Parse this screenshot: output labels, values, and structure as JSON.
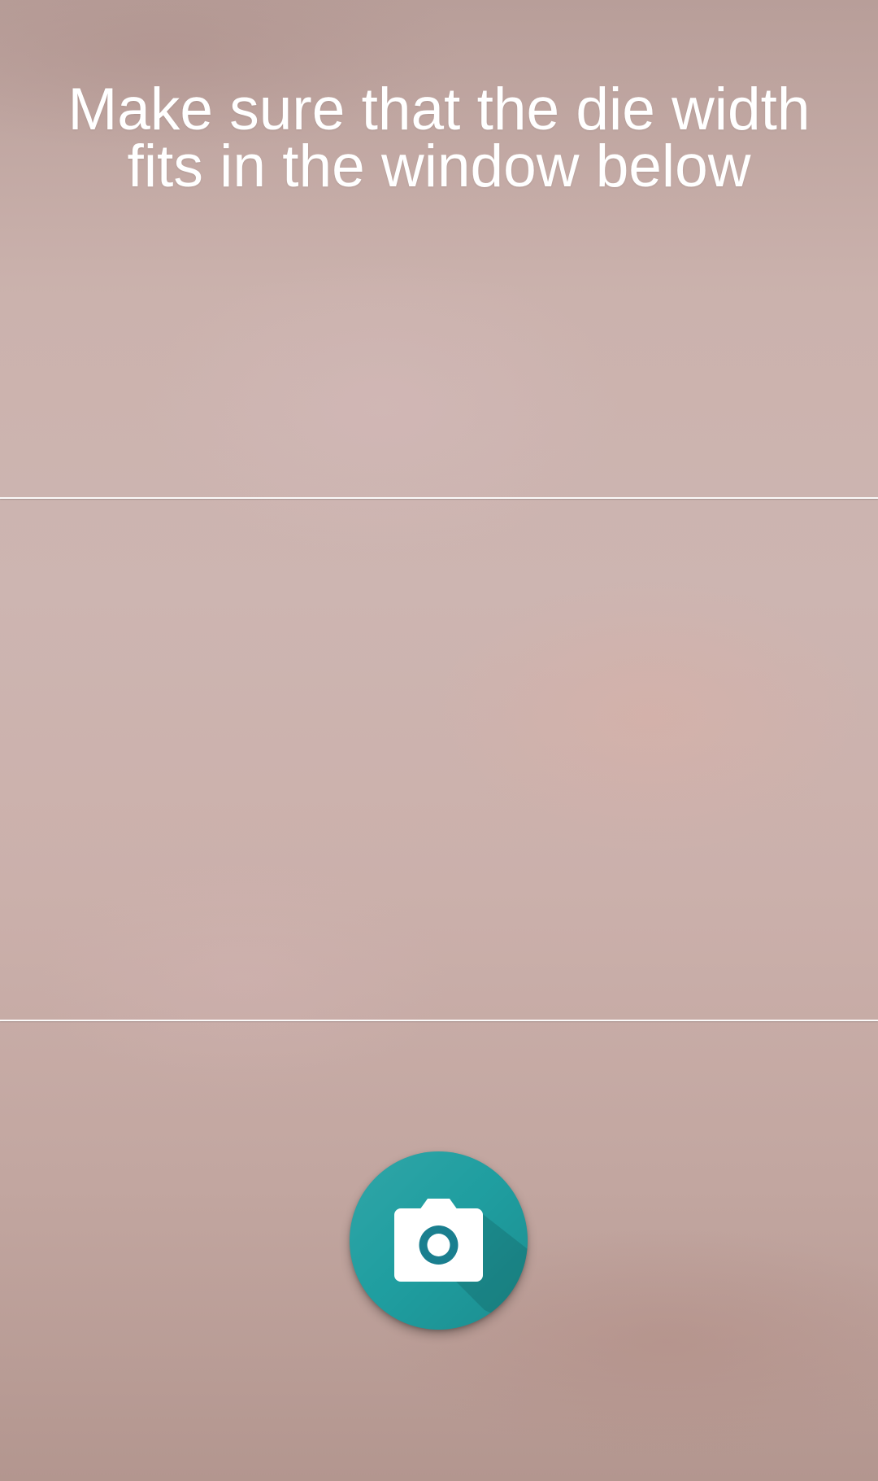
{
  "instruction": {
    "text": "Make sure that the die width\nfits in the window below",
    "color": "#ffffff"
  },
  "guide_frame": {
    "line_color": "#ffffff"
  },
  "shutter": {
    "icon": "camera-icon",
    "accent_color": "#1f9ea0"
  }
}
